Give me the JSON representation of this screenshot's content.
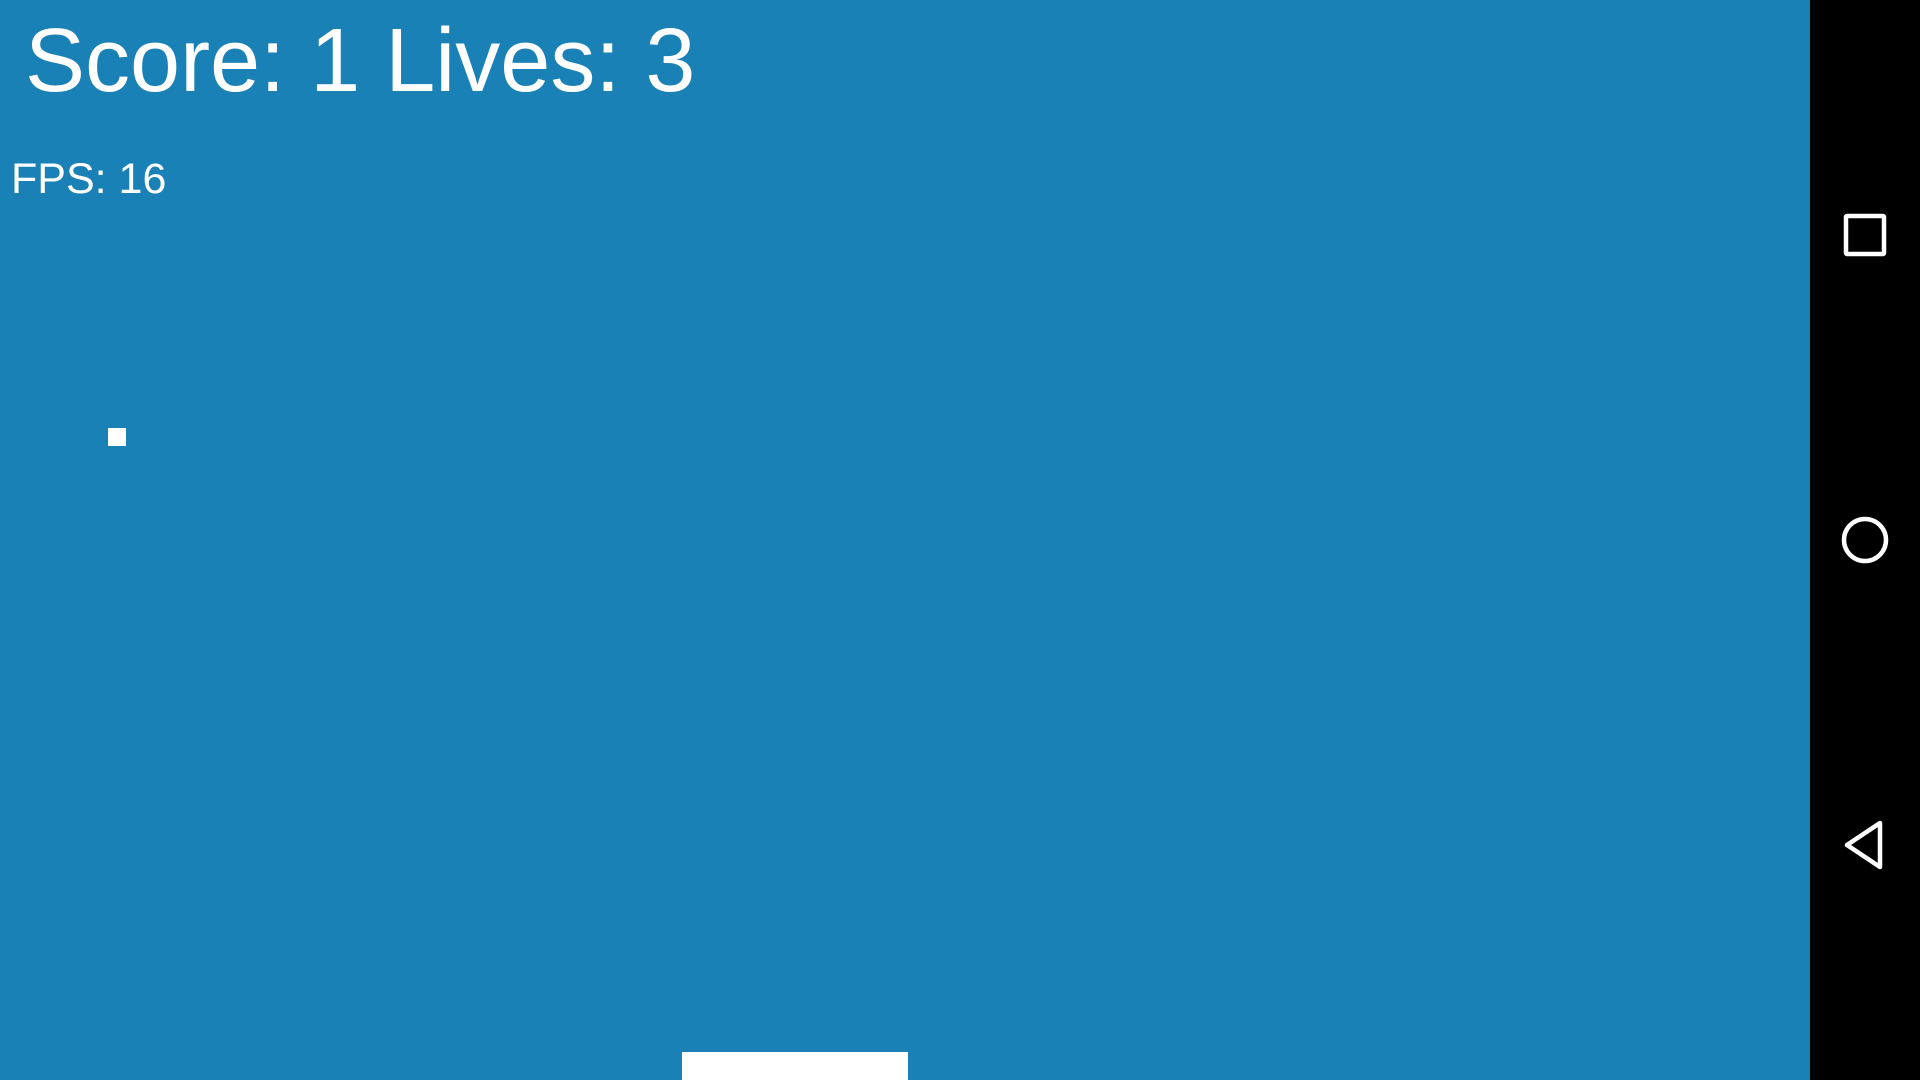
{
  "hud": {
    "score_label": "Score:",
    "score_value": "1",
    "lives_label": "Lives:",
    "lives_value": "3",
    "fps_label": "FPS:",
    "fps_value": "16"
  },
  "colors": {
    "game_background": "#1a81b6",
    "nav_bar_background": "#000000",
    "foreground": "#ffffff"
  },
  "navigation_bar": {
    "buttons": [
      {
        "name": "recents",
        "icon": "square-icon"
      },
      {
        "name": "home",
        "icon": "circle-icon"
      },
      {
        "name": "back",
        "icon": "triangle-back-icon"
      }
    ]
  }
}
